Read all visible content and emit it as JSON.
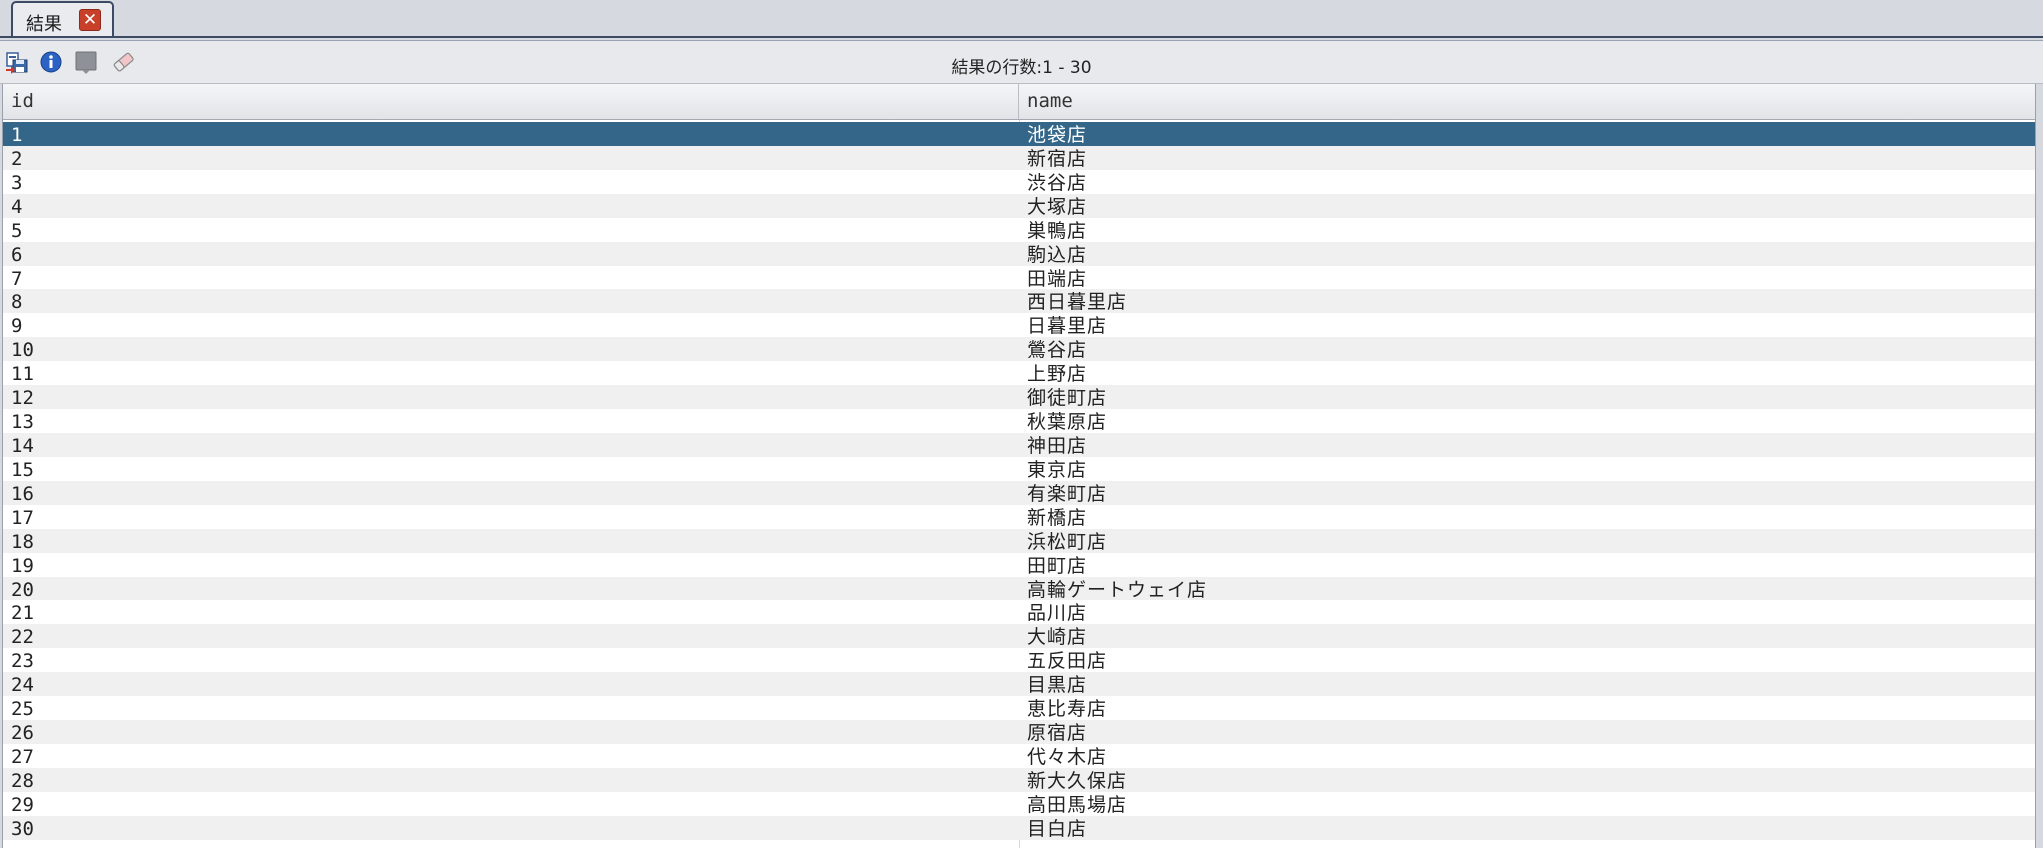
{
  "tab": {
    "label": "結果",
    "close_glyph": "✕"
  },
  "toolbar": {
    "icons": [
      "export-icon",
      "info-icon",
      "stop-icon",
      "clear-icon"
    ],
    "result_count": "結果の行数:1 - 30"
  },
  "grid": {
    "columns": [
      "id",
      "name"
    ],
    "selected_row": 0,
    "rows": [
      {
        "id": "1",
        "name": "池袋店"
      },
      {
        "id": "2",
        "name": "新宿店"
      },
      {
        "id": "3",
        "name": "渋谷店"
      },
      {
        "id": "4",
        "name": "大塚店"
      },
      {
        "id": "5",
        "name": "巣鴨店"
      },
      {
        "id": "6",
        "name": "駒込店"
      },
      {
        "id": "7",
        "name": "田端店"
      },
      {
        "id": "8",
        "name": "西日暮里店"
      },
      {
        "id": "9",
        "name": "日暮里店"
      },
      {
        "id": "10",
        "name": "鶯谷店"
      },
      {
        "id": "11",
        "name": "上野店"
      },
      {
        "id": "12",
        "name": "御徒町店"
      },
      {
        "id": "13",
        "name": "秋葉原店"
      },
      {
        "id": "14",
        "name": "神田店"
      },
      {
        "id": "15",
        "name": "東京店"
      },
      {
        "id": "16",
        "name": "有楽町店"
      },
      {
        "id": "17",
        "name": "新橋店"
      },
      {
        "id": "18",
        "name": "浜松町店"
      },
      {
        "id": "19",
        "name": "田町店"
      },
      {
        "id": "20",
        "name": "高輪ゲートウェイ店"
      },
      {
        "id": "21",
        "name": "品川店"
      },
      {
        "id": "22",
        "name": "大崎店"
      },
      {
        "id": "23",
        "name": "五反田店"
      },
      {
        "id": "24",
        "name": "目黒店"
      },
      {
        "id": "25",
        "name": "恵比寿店"
      },
      {
        "id": "26",
        "name": "原宿店"
      },
      {
        "id": "27",
        "name": "代々木店"
      },
      {
        "id": "28",
        "name": "新大久保店"
      },
      {
        "id": "29",
        "name": "高田馬場店"
      },
      {
        "id": "30",
        "name": "目白店"
      }
    ]
  },
  "colors": {
    "selected_row": "#336688",
    "tab_border": "#3c4a63",
    "close_button": "#c9402a"
  }
}
